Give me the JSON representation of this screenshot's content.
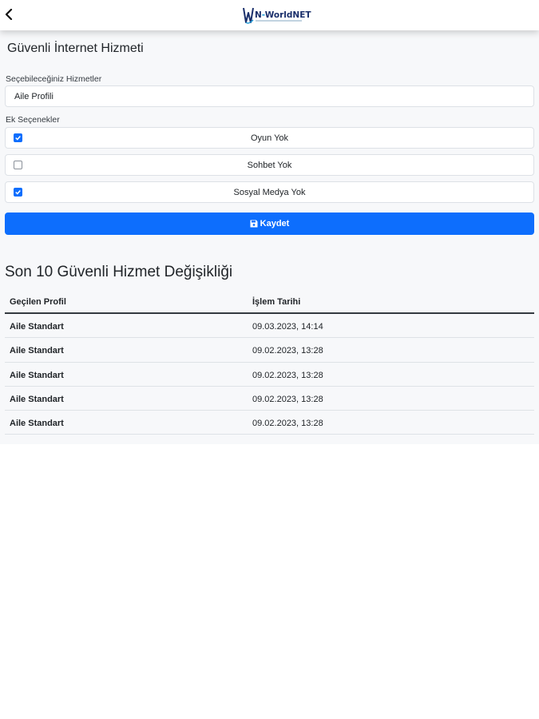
{
  "header": {
    "logo_text_a": "N",
    "logo_text_b": "WorldNET"
  },
  "form": {
    "title": "Güvenli İnternet Hizmeti",
    "services_label": "Seçebileceğiniz Hizmetler",
    "selected_service": "Aile Profili",
    "options_label": "Ek Seçenekler",
    "options": [
      {
        "label": "Oyun Yok",
        "checked": true
      },
      {
        "label": "Sohbet Yok",
        "checked": false
      },
      {
        "label": "Sosyal Medya Yok",
        "checked": true
      }
    ],
    "save_label": "Kaydet"
  },
  "history": {
    "title": "Son 10 Güvenli Hizmet Değişikliği",
    "columns": [
      "Geçilen Profil",
      "İşlem Tarihi"
    ],
    "rows": [
      {
        "profile": "Aile Standart",
        "date": "09.03.2023, 14:14"
      },
      {
        "profile": "Aile Standart",
        "date": "09.02.2023, 13:28"
      },
      {
        "profile": "Aile Standart",
        "date": "09.02.2023, 13:28"
      },
      {
        "profile": "Aile Standart",
        "date": "09.02.2023, 13:28"
      },
      {
        "profile": "Aile Standart",
        "date": "09.02.2023, 13:28"
      }
    ]
  },
  "colors": {
    "accent": "#0d6efd",
    "background": "#f7f8fa",
    "logo_dark": "#1a2f6b",
    "logo_light": "#1d9ad6"
  },
  "icons": {
    "back": "chevron-left-icon",
    "save": "floppy-disk-icon",
    "check": "checkmark-icon"
  }
}
